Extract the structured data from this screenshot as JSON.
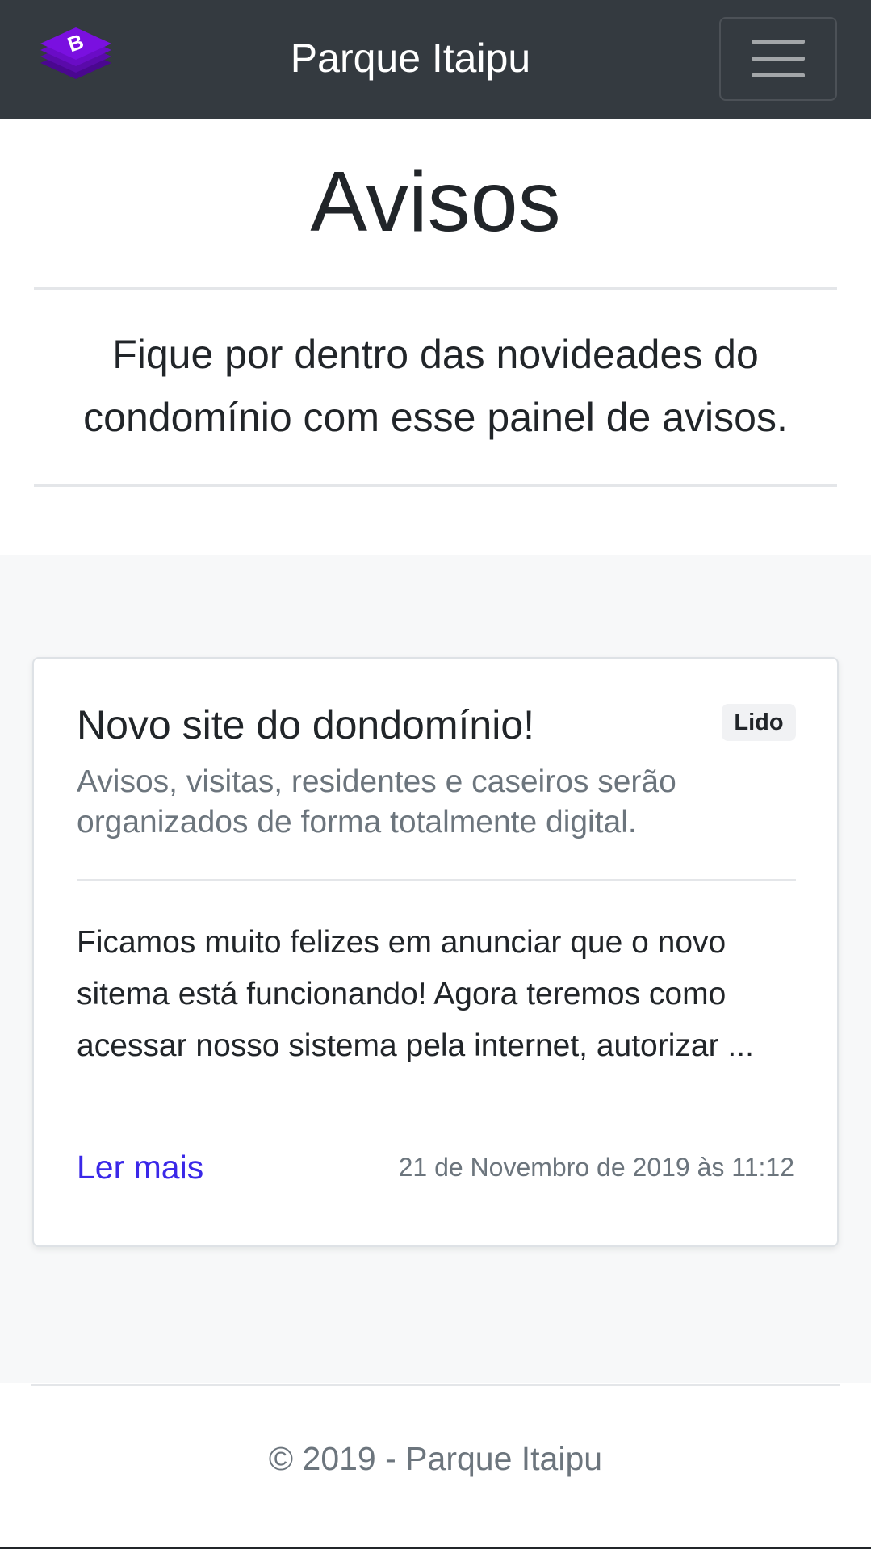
{
  "navbar": {
    "brand_title": "Parque Itaipu",
    "logo_letter": "B",
    "logo_icon": "bootstrap-logo-icon",
    "toggler_icon": "hamburger-menu-icon"
  },
  "header": {
    "title": "Avisos",
    "lead": "Fique por dentro das novideades do condomínio com esse painel de avisos."
  },
  "notices": [
    {
      "title": "Novo site do dondomínio!",
      "badge": "Lido",
      "subtitle": "Avisos, visitas, residentes e caseiros serão organizados de forma totalmente digital.",
      "body": "Ficamos muito felizes em anunciar que o novo sitema está funcionando! Agora teremos como acessar nosso sistema pela internet, autorizar ...",
      "read_more": "Ler mais",
      "date": "21 de Novembro de 2019 às 11:12"
    }
  ],
  "footer": {
    "text": "© 2019 - Parque Itaipu"
  },
  "colors": {
    "navbar_bg": "#343a40",
    "logo_purple": "#7a10e0",
    "link": "#3a28e8",
    "muted": "#6c757d",
    "section_bg": "#f7f8f9"
  }
}
